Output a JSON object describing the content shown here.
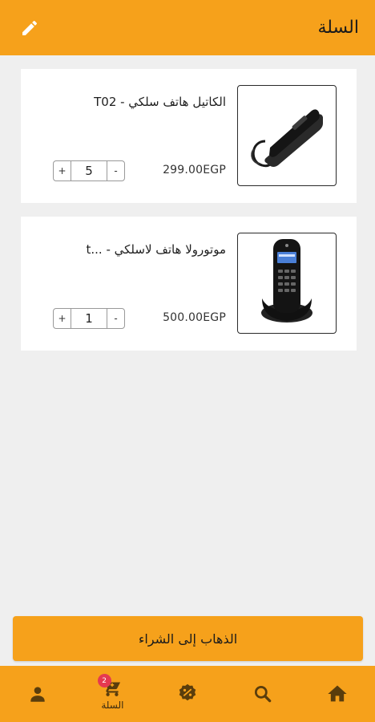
{
  "header": {
    "title": "السلة",
    "edit_icon": "pencil-icon"
  },
  "colors": {
    "accent": "#f6a11b",
    "background": "#efefef",
    "badge": "#e53950"
  },
  "cart": {
    "items": [
      {
        "name": "الكاتيل هاتف سلكي - T02",
        "price": "299.00EGP",
        "quantity": "5",
        "image_icon": "corded-phone-image"
      },
      {
        "name": "موتورولا هاتف لاسلكي - ...t",
        "price": "500.00EGP",
        "quantity": "1",
        "image_icon": "cordless-phone-image"
      }
    ],
    "plus_label": "+",
    "minus_label": "-"
  },
  "checkout": {
    "label": "الذهاب إلى الشراء"
  },
  "bottom_nav": {
    "items": [
      {
        "icon": "person-icon",
        "label": ""
      },
      {
        "icon": "cart-icon",
        "label": "السلة",
        "badge": "2"
      },
      {
        "icon": "discount-badge-icon",
        "label": ""
      },
      {
        "icon": "search-icon",
        "label": ""
      },
      {
        "icon": "home-icon",
        "label": ""
      }
    ]
  }
}
